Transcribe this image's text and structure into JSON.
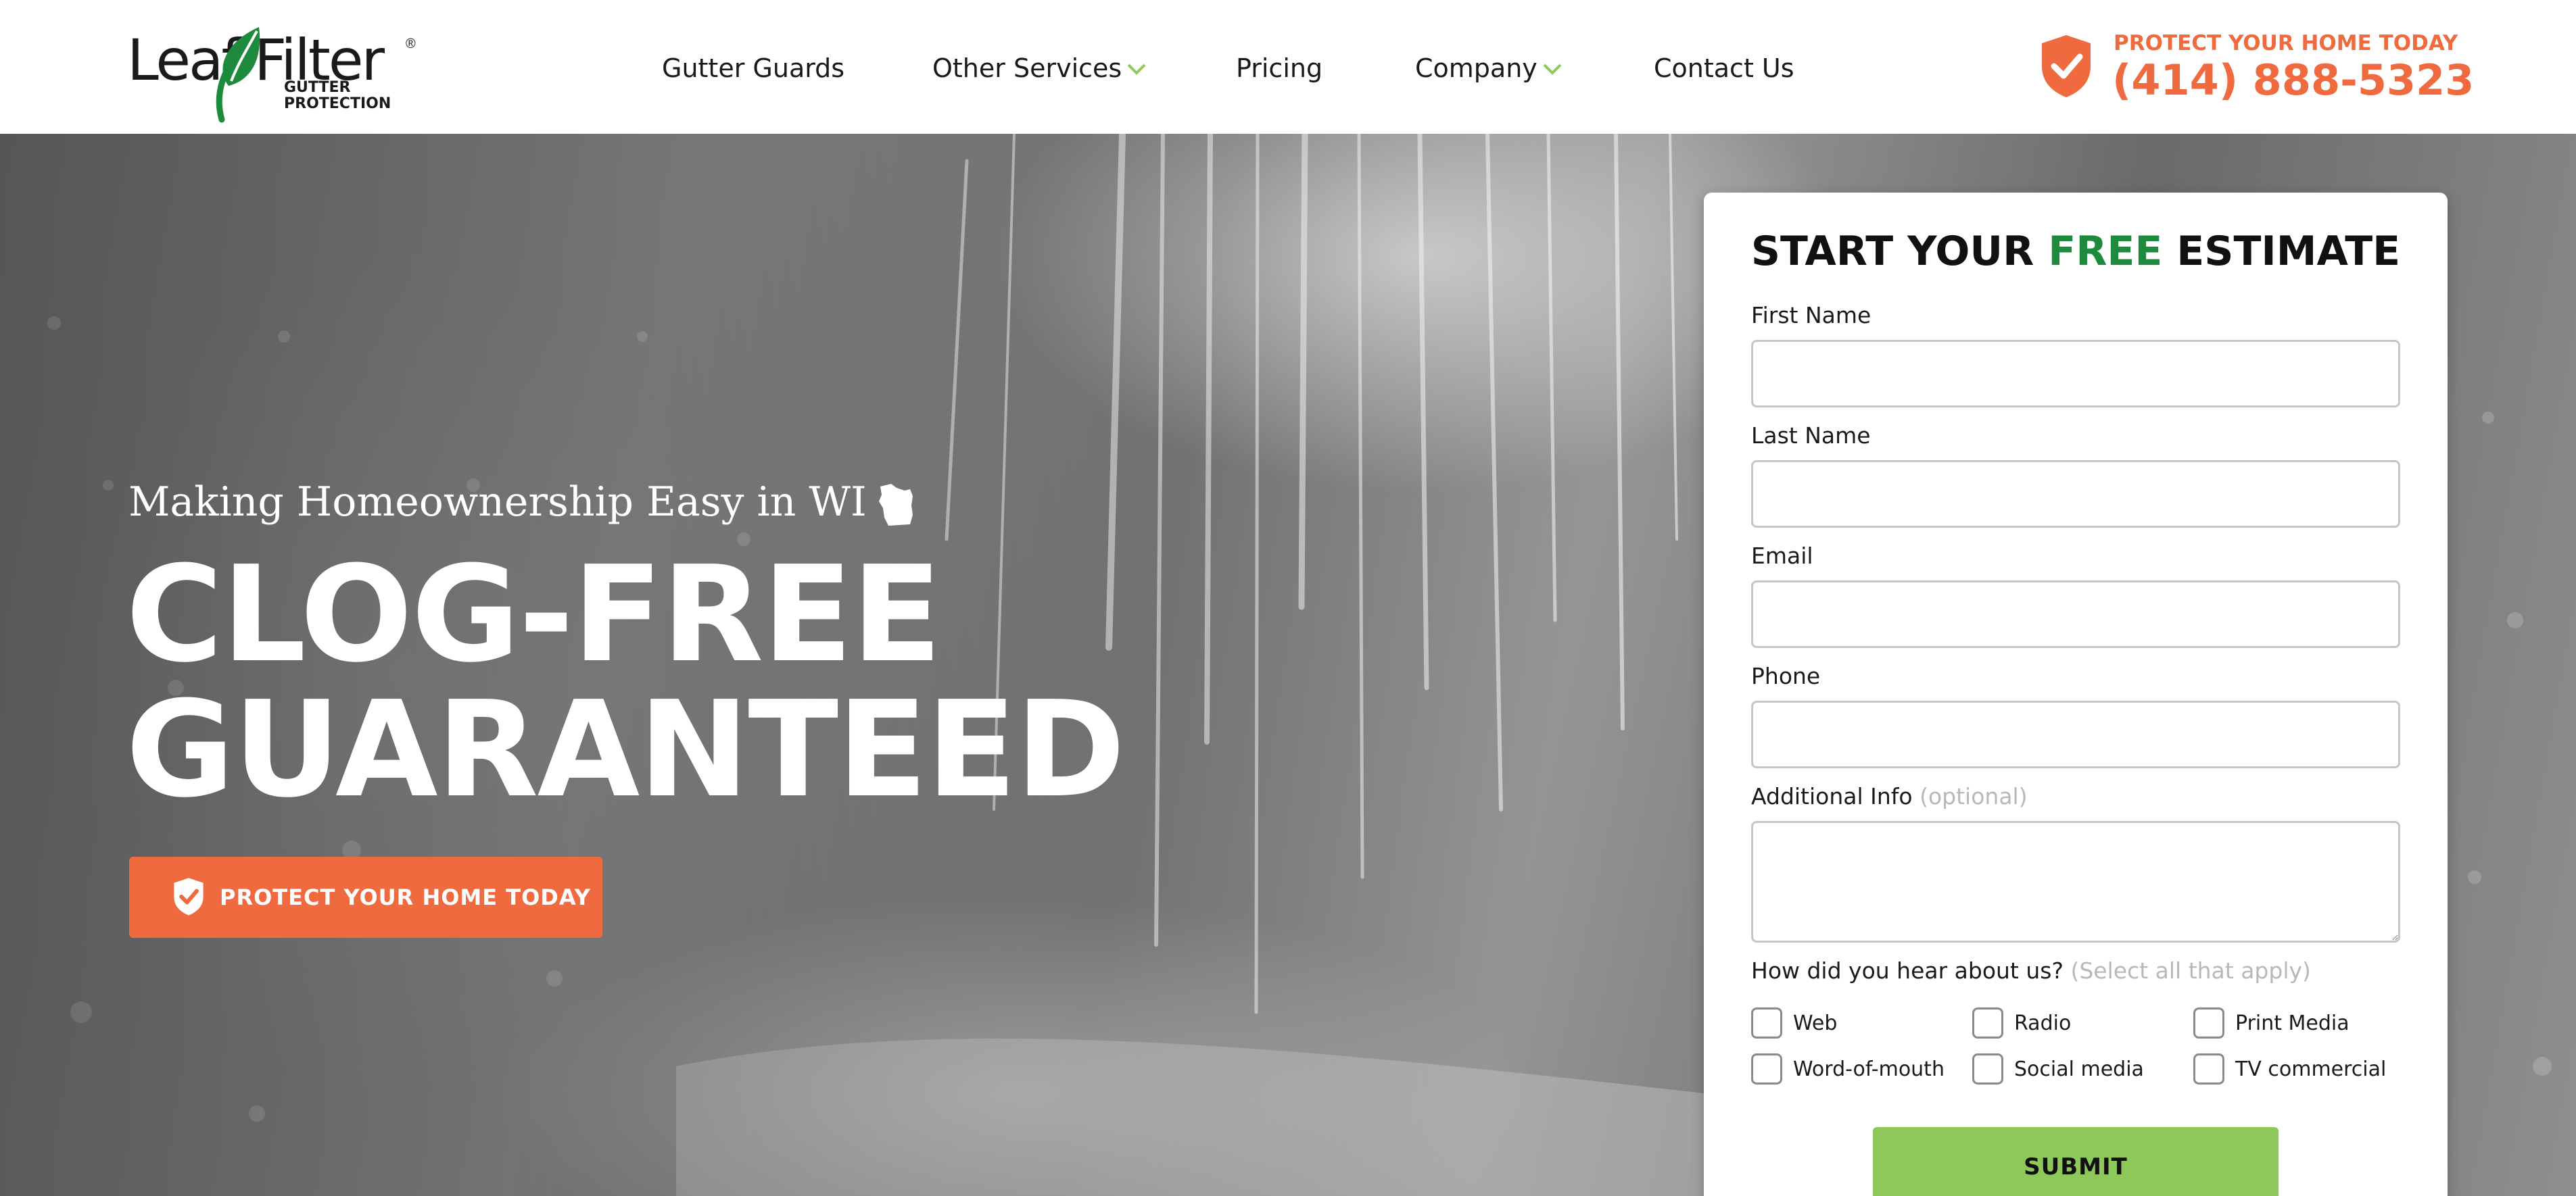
{
  "logo": {
    "word_left": "Leaf",
    "word_right": "Filter",
    "reg_mark": "®",
    "subtext": "GUTTER\nPROTECTION"
  },
  "nav": {
    "items": [
      {
        "label": "Gutter Guards",
        "has_dropdown": false
      },
      {
        "label": "Other Services",
        "has_dropdown": true
      },
      {
        "label": "Pricing",
        "has_dropdown": false
      },
      {
        "label": "Company",
        "has_dropdown": true
      },
      {
        "label": "Contact Us",
        "has_dropdown": false
      }
    ]
  },
  "header_cta": {
    "tagline": "PROTECT YOUR HOME TODAY",
    "phone": "(414) 888-5323",
    "icon": "shield-check-icon"
  },
  "hero": {
    "tagline": "Making Homeownership Easy in WI",
    "state_icon": "wisconsin-icon",
    "headline_line1": "CLOG-FREE",
    "headline_line2": "GUARANTEED",
    "cta_label": "PROTECT YOUR HOME TODAY"
  },
  "form": {
    "title_start": "START YOUR ",
    "title_free": "FREE",
    "title_end": " ESTIMATE",
    "fields": {
      "first_name": {
        "label": "First Name",
        "value": ""
      },
      "last_name": {
        "label": "Last Name",
        "value": ""
      },
      "email": {
        "label": "Email",
        "value": ""
      },
      "phone": {
        "label": "Phone",
        "value": ""
      },
      "additional_info": {
        "label": "Additional Info",
        "optional_note": "(optional)",
        "value": ""
      }
    },
    "hear_about": {
      "label": "How did you hear about us?",
      "note": "(Select all that apply)",
      "options": [
        "Web",
        "Radio",
        "Print Media",
        "Word-of-mouth",
        "Social media",
        "TV commercial"
      ]
    },
    "submit_label": "SUBMIT"
  },
  "colors": {
    "accent_orange": "#f06a3f",
    "brand_green": "#1e8a3e",
    "submit_green": "#8fc85a",
    "nav_chevron": "#8fc85a"
  }
}
